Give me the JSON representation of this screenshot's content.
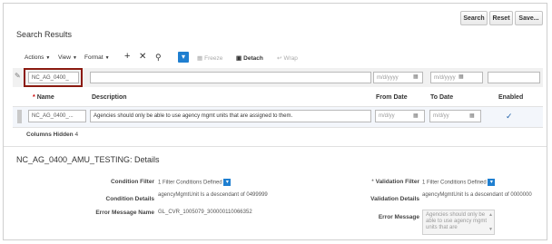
{
  "buttons": {
    "search": "Search",
    "reset": "Reset",
    "save": "Save..."
  },
  "section_title": "Search Results",
  "toolbar": {
    "actions": "Actions",
    "view": "View",
    "format": "Format",
    "freeze": "Freeze",
    "detach": "Detach",
    "wrap": "Wrap"
  },
  "filter_row": {
    "name_value": "NC_AG_0400_",
    "date_placeholder": "m/d/yyyy"
  },
  "columns": {
    "required_mark": "*",
    "name": "Name",
    "description": "Description",
    "from_date": "From Date",
    "to_date": "To Date",
    "enabled": "Enabled"
  },
  "row": {
    "name": "NC_AG_0400_...",
    "description": "Agencies should only be able to use agency mgmt units that are assigned to them.",
    "from_placeholder": "m/d/yy",
    "to_placeholder": "m/d/yy",
    "enabled": true,
    "check": "✓"
  },
  "columns_hidden": {
    "label": "Columns Hidden",
    "count": "4"
  },
  "details": {
    "title": "NC_AG_0400_AMU_TESTING: Details",
    "condition_filter": {
      "label": "Condition Filter",
      "value": "1 Filter Conditions Defined"
    },
    "condition_details": {
      "label": "Condition Details",
      "value": "agencyMgmtUnit Is a descendant of 0499999"
    },
    "error_message_name": {
      "label": "Error Message Name",
      "value": "GL_CVR_1005079_300000110066352"
    },
    "validation_filter": {
      "required_mark": "*",
      "label": "Validation Filter",
      "value": "1 Filter Conditions Defined"
    },
    "validation_details": {
      "label": "Validation Details",
      "value": "agencyMgmtUnit Is a descendant of 0000000"
    },
    "error_message": {
      "label": "Error Message",
      "value": "Agencies should only be able to use agency mgmt units that are"
    }
  },
  "colors": {
    "accent": "#1f7fd0",
    "highlight_border": "#8b1a10",
    "row_bg": "#f3f6fb"
  }
}
